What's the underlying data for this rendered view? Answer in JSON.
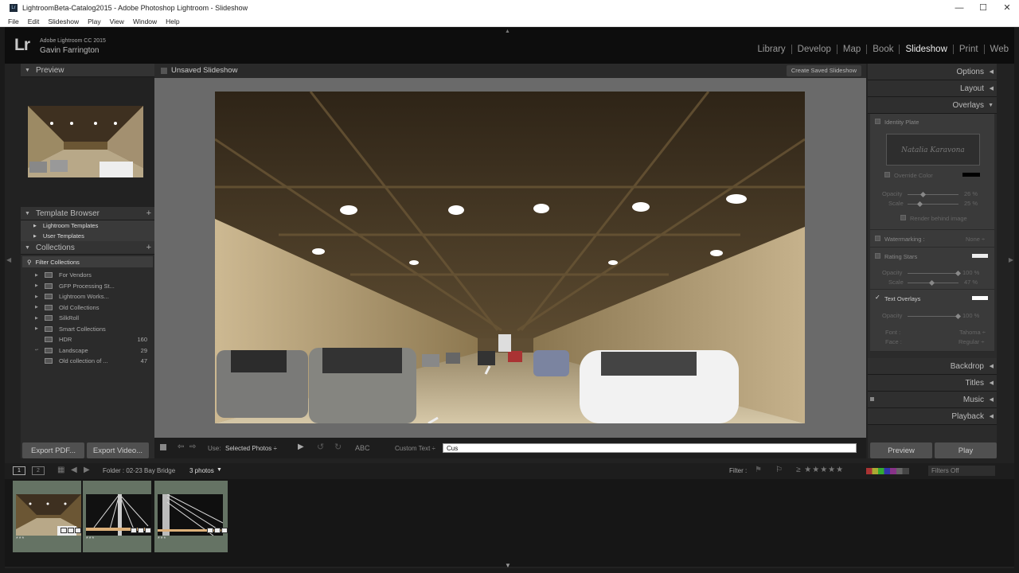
{
  "window": {
    "title": "LightroomBeta-Catalog2015 - Adobe Photoshop Lightroom - Slideshow",
    "min": "—",
    "max": "☐",
    "close": "✕"
  },
  "menu": [
    "File",
    "Edit",
    "Slideshow",
    "Play",
    "View",
    "Window",
    "Help"
  ],
  "identity": {
    "logo": "Lr",
    "product": "Adobe Lightroom CC 2015",
    "user": "Gavin Farrington"
  },
  "modules": [
    "Library",
    "Develop",
    "Map",
    "Book",
    "Slideshow",
    "Print",
    "Web"
  ],
  "left": {
    "preview": "Preview",
    "template_browser": "Template Browser",
    "templates": [
      "Lightroom Templates",
      "User Templates"
    ],
    "collections": "Collections",
    "filter": "Filter Collections",
    "items": [
      {
        "name": "For Vendors",
        "count": ""
      },
      {
        "name": "GFP Processing St...",
        "count": ""
      },
      {
        "name": "Lightroom Works...",
        "count": ""
      },
      {
        "name": "Old Collections",
        "count": ""
      },
      {
        "name": "SilkRoll",
        "count": ""
      },
      {
        "name": "Smart Collections",
        "count": ""
      },
      {
        "name": "HDR",
        "count": "160"
      },
      {
        "name": "Landscape",
        "count": "29"
      },
      {
        "name": "Old collection of ...",
        "count": "47"
      }
    ],
    "export_pdf": "Export PDF...",
    "export_video": "Export Video..."
  },
  "center": {
    "title": "Unsaved Slideshow",
    "create": "Create Saved Slideshow",
    "use_label": "Use:",
    "use_value": "Selected Photos ÷",
    "abc": "ABC",
    "custom_text": "Custom Text ÷",
    "text_value": "Cus"
  },
  "right": {
    "options": "Options",
    "layout": "Layout",
    "overlays": "Overlays",
    "identity_plate": "Identity Plate",
    "plate_text": "Natalia Karavona",
    "override_color": "Override Color",
    "opacity": "Opacity",
    "scale": "Scale",
    "ip_opacity": "26 %",
    "ip_scale": "25 %",
    "render_behind": "Render behind image",
    "watermarking": "Watermarking :",
    "watermark_value": "None ÷",
    "rating_stars": "Rating Stars",
    "rs_opacity": "100 %",
    "rs_scale": "47 %",
    "text_overlays": "Text Overlays",
    "to_opacity": "100 %",
    "font": "Font :",
    "font_value": "Tahoma ÷",
    "face": "Face :",
    "face_value": "Regular ÷",
    "backdrop": "Backdrop",
    "titles": "Titles",
    "music": "Music",
    "playback": "Playback",
    "preview_btn": "Preview",
    "play_btn": "Play"
  },
  "filmbar": {
    "page1": "1",
    "page2": "2",
    "folder": "Folder : 02-23 Bay Bridge",
    "photos": "3 photos",
    "filter": "Filter :",
    "filters_off": "Filters Off"
  },
  "thumbs": [
    {
      "stars": "***"
    },
    {
      "stars": "***"
    },
    {
      "stars": "***"
    }
  ]
}
